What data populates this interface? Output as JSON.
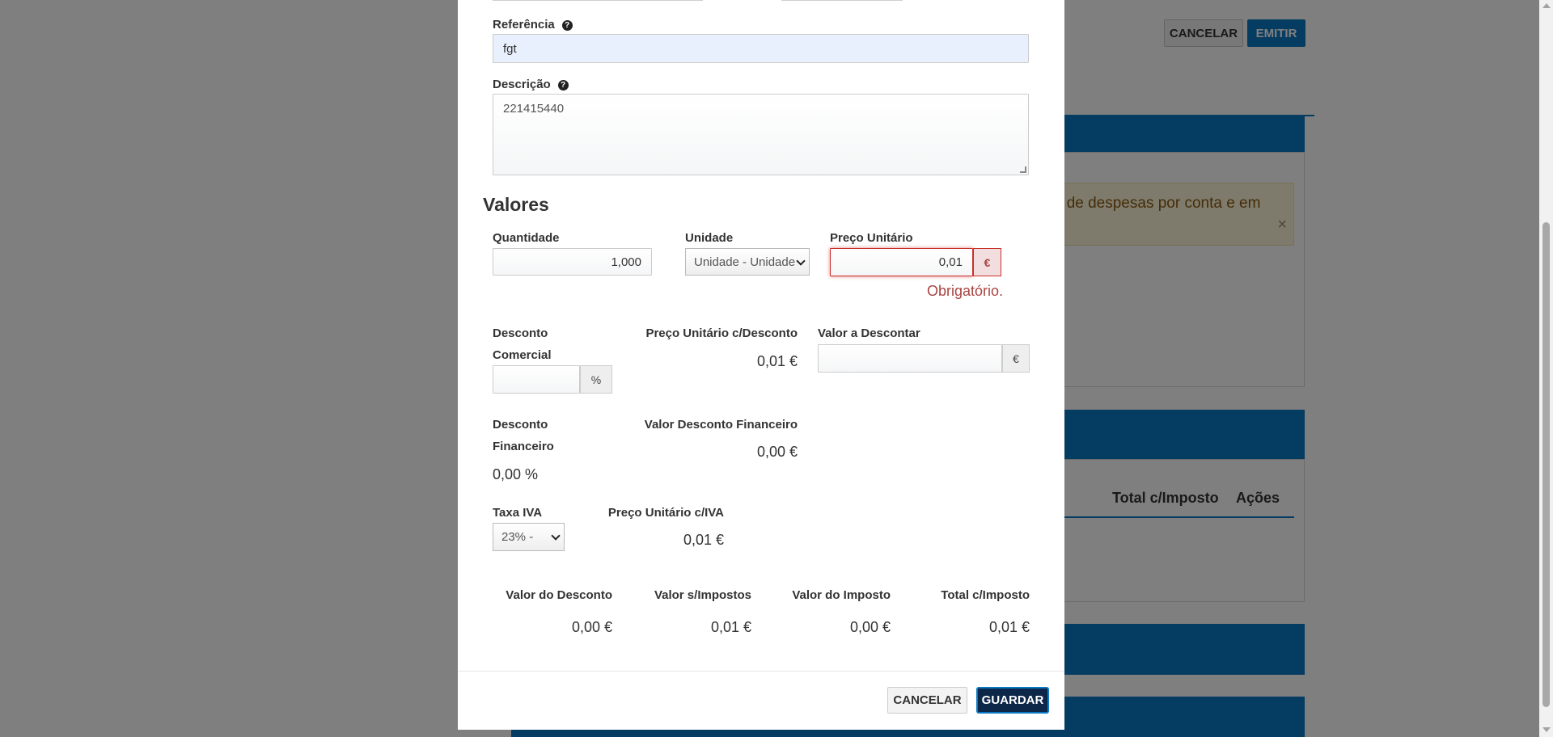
{
  "background": {
    "cancel_label": "CANCELAR",
    "emit_label": "EMITIR",
    "alert_text": "nto de despesas por conta e em",
    "alert_close": "×",
    "table_headers": [
      "Total c/Imposto",
      "Ações"
    ]
  },
  "modal": {
    "reference_label": "Referência",
    "reference_value": "fgt",
    "description_label": "Descrição",
    "description_value": "221415440",
    "help_glyph": "?",
    "section_title": "Valores",
    "quantity_label": "Quantidade",
    "quantity_value": "1,000",
    "unit_label": "Unidade",
    "unit_value": "Unidade - Unidade",
    "unit_price_label": "Preço Unitário",
    "unit_price_value": "0,01",
    "currency_symbol": "€",
    "percent_symbol": "%",
    "required_message": "Obrigatório.",
    "commercial_discount_label_1": "Desconto",
    "commercial_discount_label_2": "Comercial",
    "commercial_discount_value": "",
    "price_with_discount_label": "Preço Unitário c/Desconto",
    "price_with_discount_value": "0,01 €",
    "amount_to_discount_label": "Valor a Descontar",
    "amount_to_discount_value": "",
    "financial_discount_label_1": "Desconto",
    "financial_discount_label_2": "Financeiro",
    "financial_discount_value": "0,00 %",
    "financial_discount_amount_label": "Valor Desconto Financeiro",
    "financial_discount_amount_value": "0,00 €",
    "vat_rate_label": "Taxa IVA",
    "vat_rate_value": "23% -",
    "price_with_vat_label": "Preço Unitário c/IVA",
    "price_with_vat_value": "0,01 €",
    "summary": {
      "discount_label": "Valor do Desconto",
      "discount_value": "0,00 €",
      "net_label": "Valor s/Impostos",
      "net_value": "0,01 €",
      "tax_label": "Valor do Imposto",
      "tax_value": "0,00 €",
      "total_label": "Total c/Imposto",
      "total_value": "0,01 €"
    },
    "cancel_label": "CANCELAR",
    "save_label": "GUARDAR"
  },
  "colors": {
    "accent": "#0a78c2",
    "error": "#a94442",
    "save_button": "#0d2748",
    "alert_bg": "#fdf6d9"
  }
}
